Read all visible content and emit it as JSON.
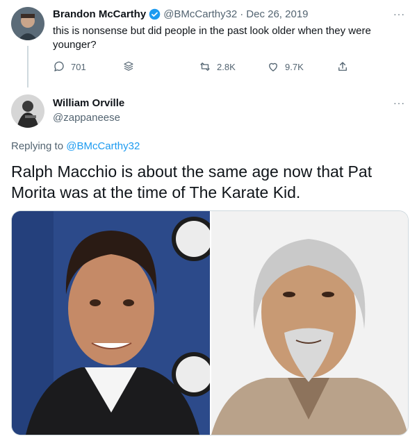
{
  "tweet1": {
    "name": "Brandon McCarthy",
    "handle": "@BMcCarthy32",
    "separator": "·",
    "date": "Dec 26, 2019",
    "text": "this is nonsense but did people in the past look older when they were younger?",
    "actions": {
      "replies": "701",
      "retweets": "2.8K",
      "likes": "9.7K"
    }
  },
  "tweet2": {
    "name": "William Orville",
    "handle": "@zappaneese",
    "replying_prefix": "Replying to",
    "replying_handle": "@BMcCarthy32",
    "text": "Ralph Macchio is about the same age now that Pat Morita was at the time of The Karate Kid."
  },
  "more_label": "···",
  "colors": {
    "verified": "#1d9bf0",
    "link": "#1d9bf0",
    "muted": "#536471"
  },
  "icons": [
    "verified-badge-icon",
    "more-icon",
    "reply-icon",
    "stack-icon",
    "retweet-icon",
    "like-icon",
    "share-icon"
  ]
}
